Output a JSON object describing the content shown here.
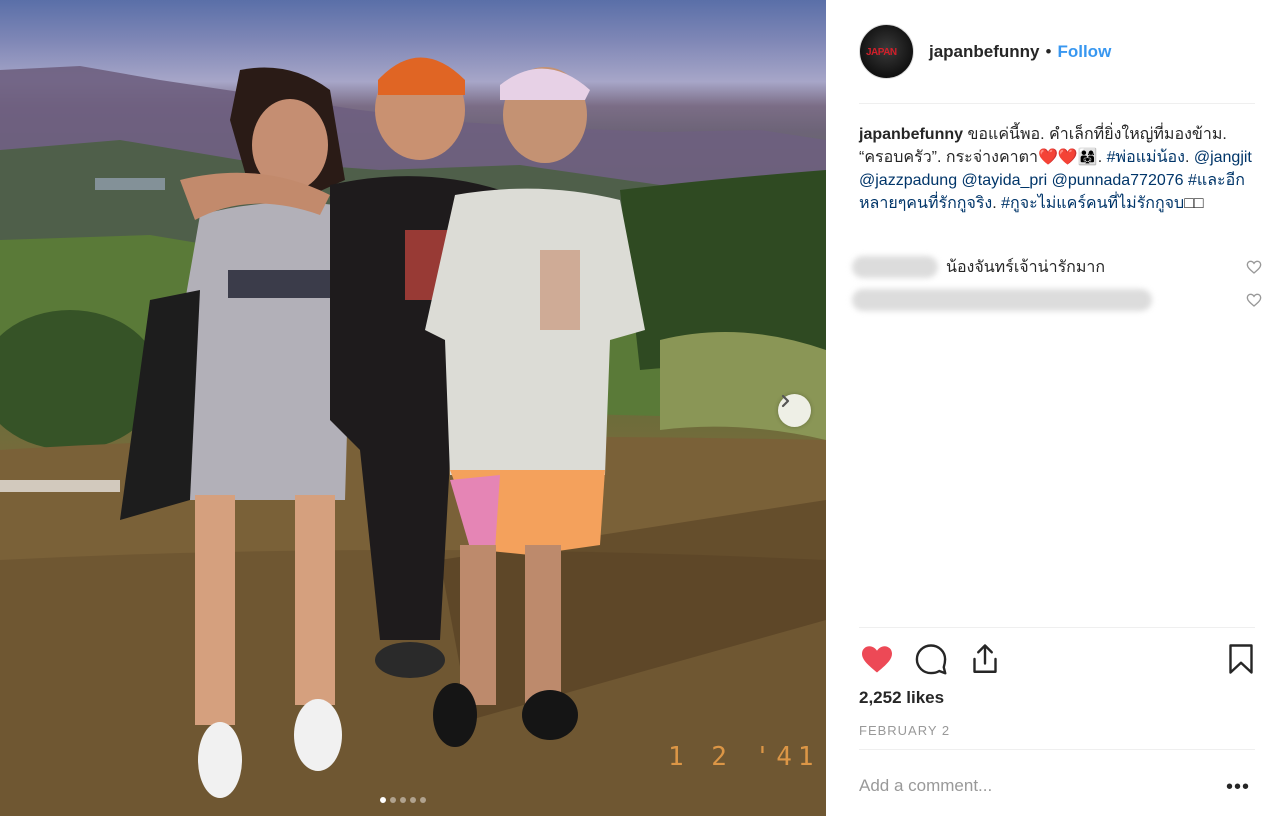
{
  "post": {
    "username": "japanbefunny",
    "separator": "•",
    "follow_label": "Follow",
    "avatar_text": "JAPAN",
    "caption": {
      "username": "japanbefunny",
      "text_1": " ขอแค่นี้พอ. คำเล็กที่ยิ่งใหญ่ที่มองข้าม. “ครอบครัว”. กระจ่างคาตา",
      "emoji": "❤️❤️👨‍👩‍👧",
      "text_2": ". ",
      "hashtag_1": "#พ่อแม่น้อง",
      "text_3": ". ",
      "mention_1": "@jangjit",
      "mention_2": "@jazzpadung",
      "mention_3": "@tayida_pri",
      "mention_4": "@punnada772076",
      "hashtag_2": "#และอีกหลายๆคนที่รักกูจริง",
      "text_4": ".",
      "hashtag_3": "#กูจะไม่แคร์คนที่ไม่รักกูจบ",
      "trail": "□□"
    },
    "comments": [
      {
        "text": "น้องจันทร์เจ้าน่ารักมาก"
      },
      {
        "text": ""
      }
    ],
    "likes": "2,252 likes",
    "date": "FEBRUARY 2",
    "add_comment_placeholder": "Add a comment...",
    "more_label": "•••",
    "photo_date_stamp": "1 2 '41",
    "carousel": {
      "total": 5,
      "active": 1
    }
  },
  "colors": {
    "link": "#003569",
    "follow": "#3897f0",
    "heart": "#ed4956",
    "muted": "#999999"
  },
  "icons": [
    "heart-filled-icon",
    "comment-icon",
    "share-icon",
    "bookmark-icon",
    "chevron-right-icon",
    "heart-outline-icon"
  ]
}
